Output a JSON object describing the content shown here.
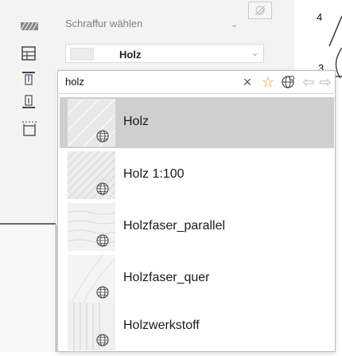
{
  "toolbar": {
    "icons": [
      "hatch-pattern-icon",
      "grid-panel-icon",
      "align-top-icon",
      "align-bottom-icon",
      "frame-icon"
    ]
  },
  "hatch_selector": {
    "label": "Schraffur wählen",
    "selected_value": "Holz"
  },
  "dropdown": {
    "search_value": "holz",
    "buttons": {
      "clear": "×",
      "favorite": "☆",
      "global": "🌐",
      "back": "⇦",
      "forward": "⇨"
    },
    "items": [
      {
        "name": "Holz",
        "selected": true
      },
      {
        "name": "Holz 1:100",
        "selected": false
      },
      {
        "name": "Holzfaser_parallel",
        "selected": false
      },
      {
        "name": "Holzfaser_quer",
        "selected": false
      },
      {
        "name": "Holzwerkstoff",
        "selected": false
      }
    ]
  },
  "drawing": {
    "labels": [
      "4",
      "3"
    ]
  },
  "colors": {
    "accent_star": "#d8a300",
    "selected_row": "#cfcfcf"
  }
}
